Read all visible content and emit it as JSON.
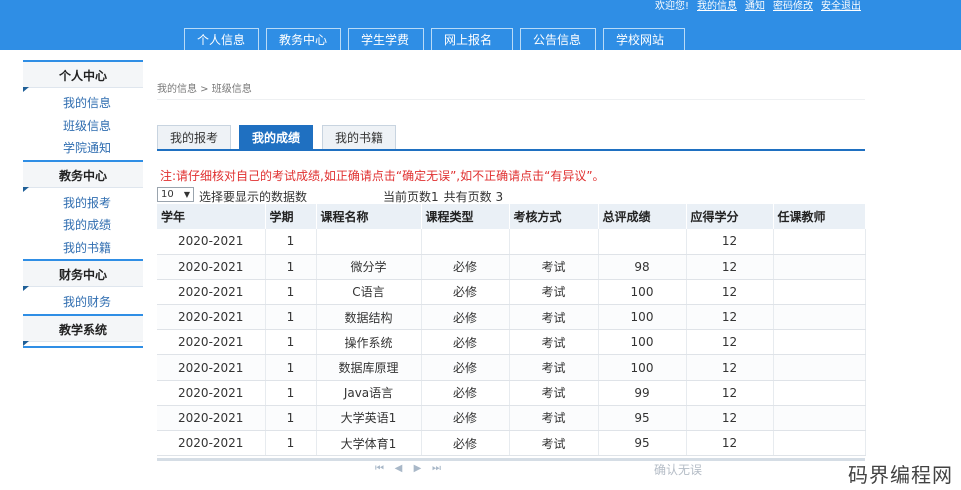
{
  "top_links": {
    "welcome": "欢迎您!",
    "my_info": "我的信息",
    "notice": "通知",
    "change_password": "密码修改",
    "logout": "安全退出"
  },
  "main_nav": [
    "个人信息",
    "教务中心",
    "学生学费",
    "网上报名",
    "公告信息",
    "学校网站"
  ],
  "sidebar": {
    "groups": [
      {
        "title": "个人中心",
        "items": [
          "我的信息",
          "班级信息",
          "学院通知"
        ]
      },
      {
        "title": "教务中心",
        "items": [
          "我的报考",
          "我的成绩",
          "我的书籍"
        ]
      },
      {
        "title": "财务中心",
        "items": [
          "我的财务"
        ]
      },
      {
        "title": "教学系统",
        "items": []
      }
    ]
  },
  "breadcrumb": "我的信息 > 班级信息",
  "tabs": [
    {
      "label": "我的报考",
      "active": false
    },
    {
      "label": "我的成绩",
      "active": true
    },
    {
      "label": "我的书籍",
      "active": false
    }
  ],
  "notice": "注:请仔细核对自己的考试成绩,如正确请点击“确定无误”,如不正确请点击“有异议”。",
  "pager": {
    "page_size": "10",
    "page_size_label": "选择要显示的数据数",
    "current_page": "当前页数1",
    "total_pages": "共有页数 3"
  },
  "table": {
    "headers": [
      "学年",
      "学期",
      "课程名称",
      "课程类型",
      "考核方式",
      "总评成绩",
      "应得学分",
      "任课教师"
    ],
    "rows": [
      [
        "2020-2021",
        "1",
        "",
        "",
        "",
        "",
        "12",
        ""
      ],
      [
        "2020-2021",
        "1",
        "微分学",
        "必修",
        "考试",
        "98",
        "12",
        ""
      ],
      [
        "2020-2021",
        "1",
        "C语言",
        "必修",
        "考试",
        "100",
        "12",
        ""
      ],
      [
        "2020-2021",
        "1",
        "数据结构",
        "必修",
        "考试",
        "100",
        "12",
        ""
      ],
      [
        "2020-2021",
        "1",
        "操作系统",
        "必修",
        "考试",
        "100",
        "12",
        ""
      ],
      [
        "2020-2021",
        "1",
        "数据库原理",
        "必修",
        "考试",
        "100",
        "12",
        ""
      ],
      [
        "2020-2021",
        "1",
        "Java语言",
        "必修",
        "考试",
        "99",
        "12",
        ""
      ],
      [
        "2020-2021",
        "1",
        "大学英语1",
        "必修",
        "考试",
        "95",
        "12",
        ""
      ],
      [
        "2020-2021",
        "1",
        "大学体育1",
        "必修",
        "考试",
        "95",
        "12",
        ""
      ]
    ]
  },
  "footer": {
    "confirm_label": "确认无误"
  },
  "watermark": "码界编程网",
  "colors": {
    "header_bg": "#2f8ee5",
    "tab_active": "#1f70c1",
    "notice": "#e03030",
    "link": "#2f6db0"
  },
  "icons": [
    "first-page-icon",
    "prev-page-icon",
    "next-page-icon",
    "last-page-icon",
    "select-caret-icon"
  ]
}
